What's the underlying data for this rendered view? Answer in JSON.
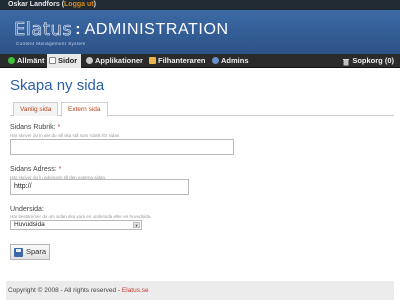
{
  "topbar": {
    "user": "Oskar Landfors",
    "logout": "Logga ut"
  },
  "header": {
    "brand": "Elatus",
    "separator": ":",
    "title": "ADMINISTRATION",
    "tagline": "Content  Management  System"
  },
  "nav": {
    "items": [
      {
        "label": "Allmänt",
        "icon": "green-dot-icon"
      },
      {
        "label": "Sidor",
        "icon": "page-icon"
      },
      {
        "label": "Applikationer",
        "icon": "gear-icon"
      },
      {
        "label": "Filhanteraren",
        "icon": "folder-icon"
      },
      {
        "label": "Admins",
        "icon": "user-icon"
      }
    ],
    "cart": "Sopkorg (0)"
  },
  "page": {
    "title": "Skapa ny sida"
  },
  "tabs": [
    {
      "label": "Vanlig sida"
    },
    {
      "label": "Extern sida"
    }
  ],
  "form": {
    "rubrik": {
      "label": "Sidans Rubrik:",
      "required": "*",
      "hint": "Här skriver du in det du vill ska stå som rubrik för sidan.",
      "value": ""
    },
    "adress": {
      "label": "Sidans Adress:",
      "required": "*",
      "hint": "Här skriver du in adressen till den externa sidan.",
      "value": "http://"
    },
    "undersida": {
      "label": "Undersida:",
      "hint": "Här bestämmer du om sidan ska vara en undersida eller en huvudsida.",
      "selected": "Huvudsida"
    },
    "save": "Spara"
  },
  "footer": {
    "text": "Copyright © 2008 - All rights reserved - ",
    "link": "Elatus.se"
  },
  "colors": {
    "accent": "#2a5fa8",
    "header": "#3c6aa6",
    "nav": "#2b2b2b",
    "tab_text": "#b2421a",
    "required": "#c0392b"
  }
}
